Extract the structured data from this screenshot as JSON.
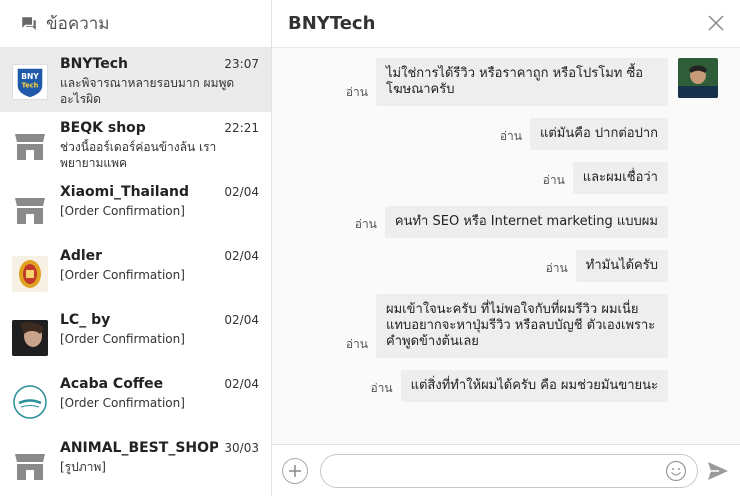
{
  "sidebar": {
    "title": "ข้อความ",
    "conversations": [
      {
        "name": "BNYTech",
        "time": "23:07",
        "snippet": "และพิจารณาหลายรอบมาก ผมพูดอะไรผิด",
        "avatar": "bnytech-logo"
      },
      {
        "name": "BEQK shop",
        "time": "22:21",
        "snippet": "ช่วงนี้ออร์เดอร์ค่อนข้างล้น เราพยายามแพค",
        "avatar": "shop-icon"
      },
      {
        "name": "Xiaomi_Thailand",
        "time": "02/04",
        "snippet": "[Order Confirmation]",
        "avatar": "shop-icon"
      },
      {
        "name": "Adler",
        "time": "02/04",
        "snippet": "[Order Confirmation]",
        "avatar": "adler-logo"
      },
      {
        "name": "LC_ by",
        "time": "02/04",
        "snippet": "[Order Confirmation]",
        "avatar": "lc-photo"
      },
      {
        "name": "Acaba Coffee",
        "time": "02/04",
        "snippet": "[Order Confirmation]",
        "avatar": "acaba-logo"
      },
      {
        "name": "ANIMAL_BEST_SHOP",
        "time": "30/03",
        "snippet": "[รูปภาพ]",
        "avatar": "shop-icon"
      }
    ]
  },
  "chat": {
    "title": "BNYTech",
    "read_label": "อ่าน",
    "messages": [
      {
        "text": "ไม่ใช่การได้รีวิว หรือราคาถูก หรือโปรโมท ซื้อโฆษณาครับ"
      },
      {
        "text": "แต่มันคือ ปากต่อปาก"
      },
      {
        "text": "และผมเชื่อว่า"
      },
      {
        "text": "คนทำ SEO หรือ Internet marketing แบบผม"
      },
      {
        "text": "ทำมันได้ครับ"
      },
      {
        "text": "ผมเข้าใจนะครับ ที่ไม่พอใจกับที่ผมรีวิว ผมเนี่ยแทบอยากจะหาปุ่มรีวิว หรือลบบัญชี ตัวเองเพราะคำพูดข้างต้นเลย"
      },
      {
        "text": "แต่สิ่งที่ทำให้ผมได้ครับ คือ ผมช่วยมันขายนะ"
      }
    ]
  },
  "composer": {
    "input_value": "",
    "input_placeholder": ""
  },
  "colors": {
    "active_row": "#ebebeb",
    "bubble": "#eeeeee",
    "shop_gray": "#8a8a8a",
    "bny_blue": "#1e5aa8"
  }
}
